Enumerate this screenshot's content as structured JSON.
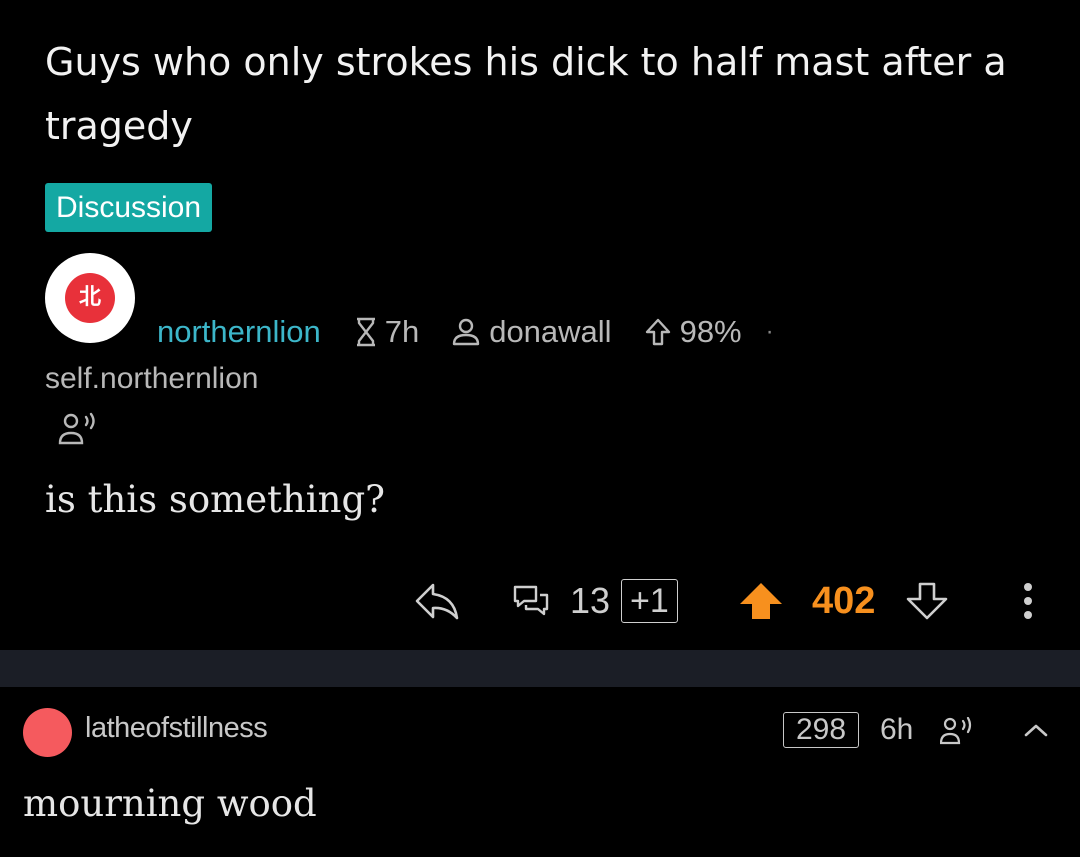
{
  "post": {
    "title": "Guys who only strokes his dick to half mast after a tragedy",
    "flair": "Discussion",
    "flair_color": "#14a8a3",
    "avatar_text": "北",
    "avatar_color": "#e8313a",
    "community": "northernlion",
    "community_color": "#3cb6c9",
    "time": "7h",
    "author": "donawall",
    "upvote_ratio": "98%",
    "domain": "self.northernlion",
    "body": "is this something?",
    "comment_count": "13",
    "new_comments": "+1",
    "score": "402",
    "score_color": "#f7901e",
    "icons": {
      "time": "hourglass-icon",
      "author": "user-icon",
      "ratio": "upvote-outline-icon",
      "speaker": "speaker-icon",
      "reply": "reply-icon",
      "comments": "comments-icon",
      "upvote": "upvote-filled-icon",
      "downvote": "downvote-icon",
      "more": "more-vertical-icon"
    }
  },
  "comment": {
    "username": "latheofstillness",
    "avatar_color": "#f55a5e",
    "score": "298",
    "time": "6h",
    "body": "mourning wood",
    "icons": {
      "speaker": "speaker-icon",
      "collapse": "chevron-up-icon"
    }
  }
}
